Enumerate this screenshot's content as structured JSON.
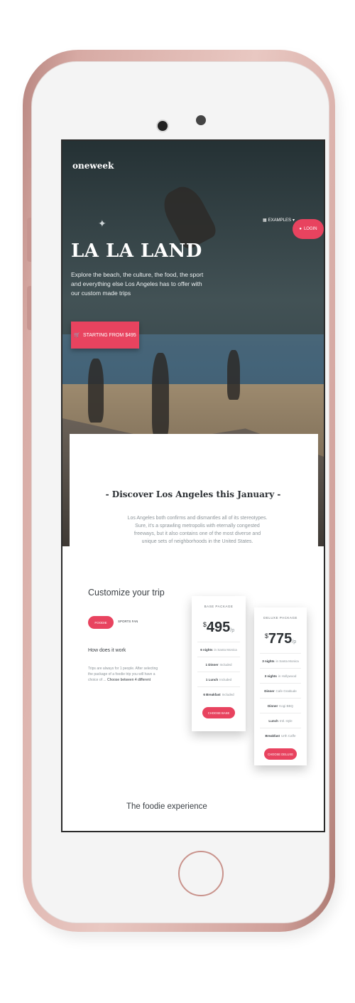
{
  "brand": "oneweek",
  "nav": {
    "examples_label": "EXAMPLES",
    "login_label": "LOGIN"
  },
  "hero": {
    "title": "LA LA LAND",
    "description": "Explore the beach, the culture, the food, the sport and everything else Los Angeles has to offer with our custom made trips",
    "cta_label": "STARTING FROM $495"
  },
  "discover": {
    "title": "- Discover Los Angeles this January -",
    "text": "Los Angeles both confirms and dismantles all of its stereotypes. Sure, it's a sprawling metropolis with eternally congested freeways, but it also contains one of the most diverse and unique sets of neighborhoods in the United States."
  },
  "customize": {
    "title": "Customize your trip",
    "pill_active": "FOODIE",
    "pill_other": "SPORTS FAN",
    "how_title": "How does it work",
    "how_text": "Trips are always for 1 people. After selecting the package of a foodie trip you will have a choice of ...",
    "how_text_bold": "Choose between 4 different"
  },
  "base_package": {
    "name": "BASE PACKAGE",
    "currency": "$",
    "price": "495",
    "per": "/p",
    "rows": [
      {
        "bold": "6 nights",
        "light": "in Santa Monica"
      },
      {
        "bold": "1 Dinner",
        "light": "Included"
      },
      {
        "bold": "1 Lunch",
        "light": "Included"
      },
      {
        "bold": "6 Breakfast",
        "light": "Included"
      }
    ],
    "button": "CHOOSE BASE"
  },
  "deluxe_package": {
    "name": "DELUXE PACKAGE",
    "currency": "$",
    "price": "775",
    "per": "/p",
    "rows": [
      {
        "bold": "3 nights",
        "light": "in Santa Monica"
      },
      {
        "bold": "3 nights",
        "light": "in Hollywood"
      },
      {
        "bold": "Dinner",
        "light": "Cafe Gratitude"
      },
      {
        "bold": "Dinner",
        "light": "Kogi BBQ"
      },
      {
        "bold": "Lunch",
        "light": "Intl. style"
      },
      {
        "bold": "Breakfast",
        "light": "Urth Caffe"
      }
    ],
    "button": "CHOOSE DELUXE"
  },
  "foodie_title": "The foodie experience",
  "colors": {
    "accent": "#e8435f",
    "phone_rose_gold": "#d7aaa4"
  },
  "icons": {
    "examples": "book-icon",
    "login": "user-icon",
    "cart": "cart-icon"
  }
}
